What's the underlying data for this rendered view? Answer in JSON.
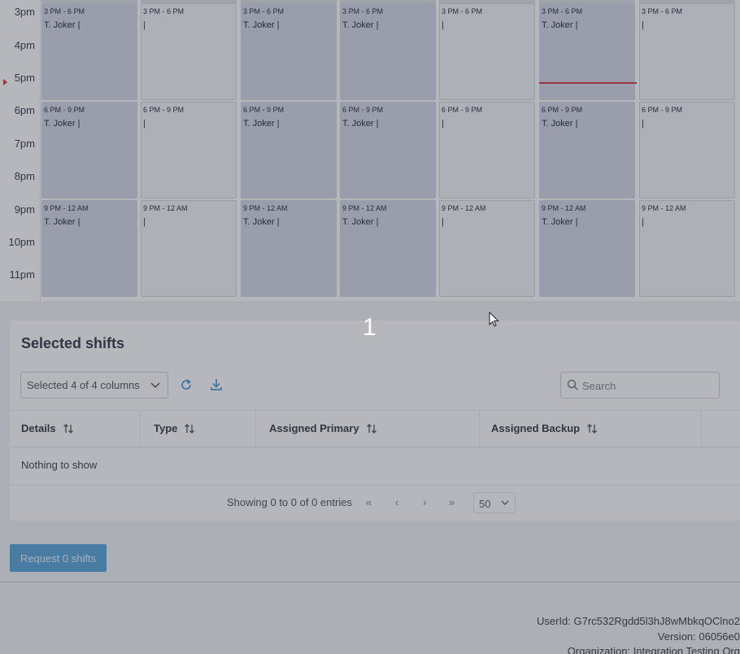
{
  "calendar": {
    "hours": [
      "3pm",
      "4pm",
      "5pm",
      "6pm",
      "7pm",
      "8pm",
      "9pm",
      "10pm",
      "11pm"
    ],
    "days": [
      {
        "assigned": true,
        "now_line": false,
        "shifts": [
          {
            "time": "3 PM - 6 PM",
            "who": "T. Joker |"
          },
          {
            "time": "6 PM - 9 PM",
            "who": "T. Joker |"
          },
          {
            "time": "9 PM - 12 AM",
            "who": "T. Joker |"
          }
        ]
      },
      {
        "assigned": false,
        "now_line": false,
        "shifts": [
          {
            "time": "3 PM - 6 PM",
            "who": "|"
          },
          {
            "time": "6 PM - 9 PM",
            "who": "|"
          },
          {
            "time": "9 PM - 12 AM",
            "who": "|"
          }
        ]
      },
      {
        "assigned": true,
        "now_line": false,
        "shifts": [
          {
            "time": "3 PM - 6 PM",
            "who": "T. Joker |"
          },
          {
            "time": "6 PM - 9 PM",
            "who": "T. Joker |"
          },
          {
            "time": "9 PM - 12 AM",
            "who": "T. Joker |"
          }
        ]
      },
      {
        "assigned": true,
        "now_line": false,
        "shifts": [
          {
            "time": "3 PM - 6 PM",
            "who": "T. Joker |"
          },
          {
            "time": "6 PM - 9 PM",
            "who": "T. Joker |"
          },
          {
            "time": "9 PM - 12 AM",
            "who": "T. Joker |"
          }
        ]
      },
      {
        "assigned": false,
        "now_line": false,
        "shifts": [
          {
            "time": "3 PM - 6 PM",
            "who": "|"
          },
          {
            "time": "6 PM - 9 PM",
            "who": "|"
          },
          {
            "time": "9 PM - 12 AM",
            "who": "|"
          }
        ]
      },
      {
        "assigned": true,
        "now_line": true,
        "shifts": [
          {
            "time": "3 PM - 6 PM",
            "who": "T. Joker |"
          },
          {
            "time": "6 PM - 9 PM",
            "who": "T. Joker |"
          },
          {
            "time": "9 PM - 12 AM",
            "who": "T. Joker |"
          }
        ]
      },
      {
        "assigned": false,
        "now_line": false,
        "shifts": [
          {
            "time": "3 PM - 6 PM",
            "who": "|"
          },
          {
            "time": "6 PM - 9 PM",
            "who": "|"
          },
          {
            "time": "9 PM - 12 AM",
            "who": "|"
          }
        ]
      }
    ]
  },
  "selected_shifts": {
    "title": "Selected shifts",
    "column_selector": "Selected 4 of 4 columns",
    "search_placeholder": "Search",
    "columns": [
      "Details",
      "Type",
      "Assigned Primary",
      "Assigned Backup"
    ],
    "empty_text": "Nothing to show",
    "pager": {
      "info": "Showing 0 to 0 of 0 entries",
      "first": "«",
      "prev": "‹",
      "next": "›",
      "last": "»",
      "page_size": "50"
    }
  },
  "request_button": "Request 0 shifts",
  "footer": {
    "user_id": "UserId: G7rc532Rgdd5l3hJ8wMbkqOClno2",
    "version": "Version: 06056e0",
    "organization": "Organization: Integration Testing Org"
  },
  "overlay": {
    "number": "1"
  },
  "colors": {
    "assigned": "#d6d9e8",
    "open": "#f4f5f7",
    "now": "#d94040",
    "accent": "#5fa8d8"
  }
}
